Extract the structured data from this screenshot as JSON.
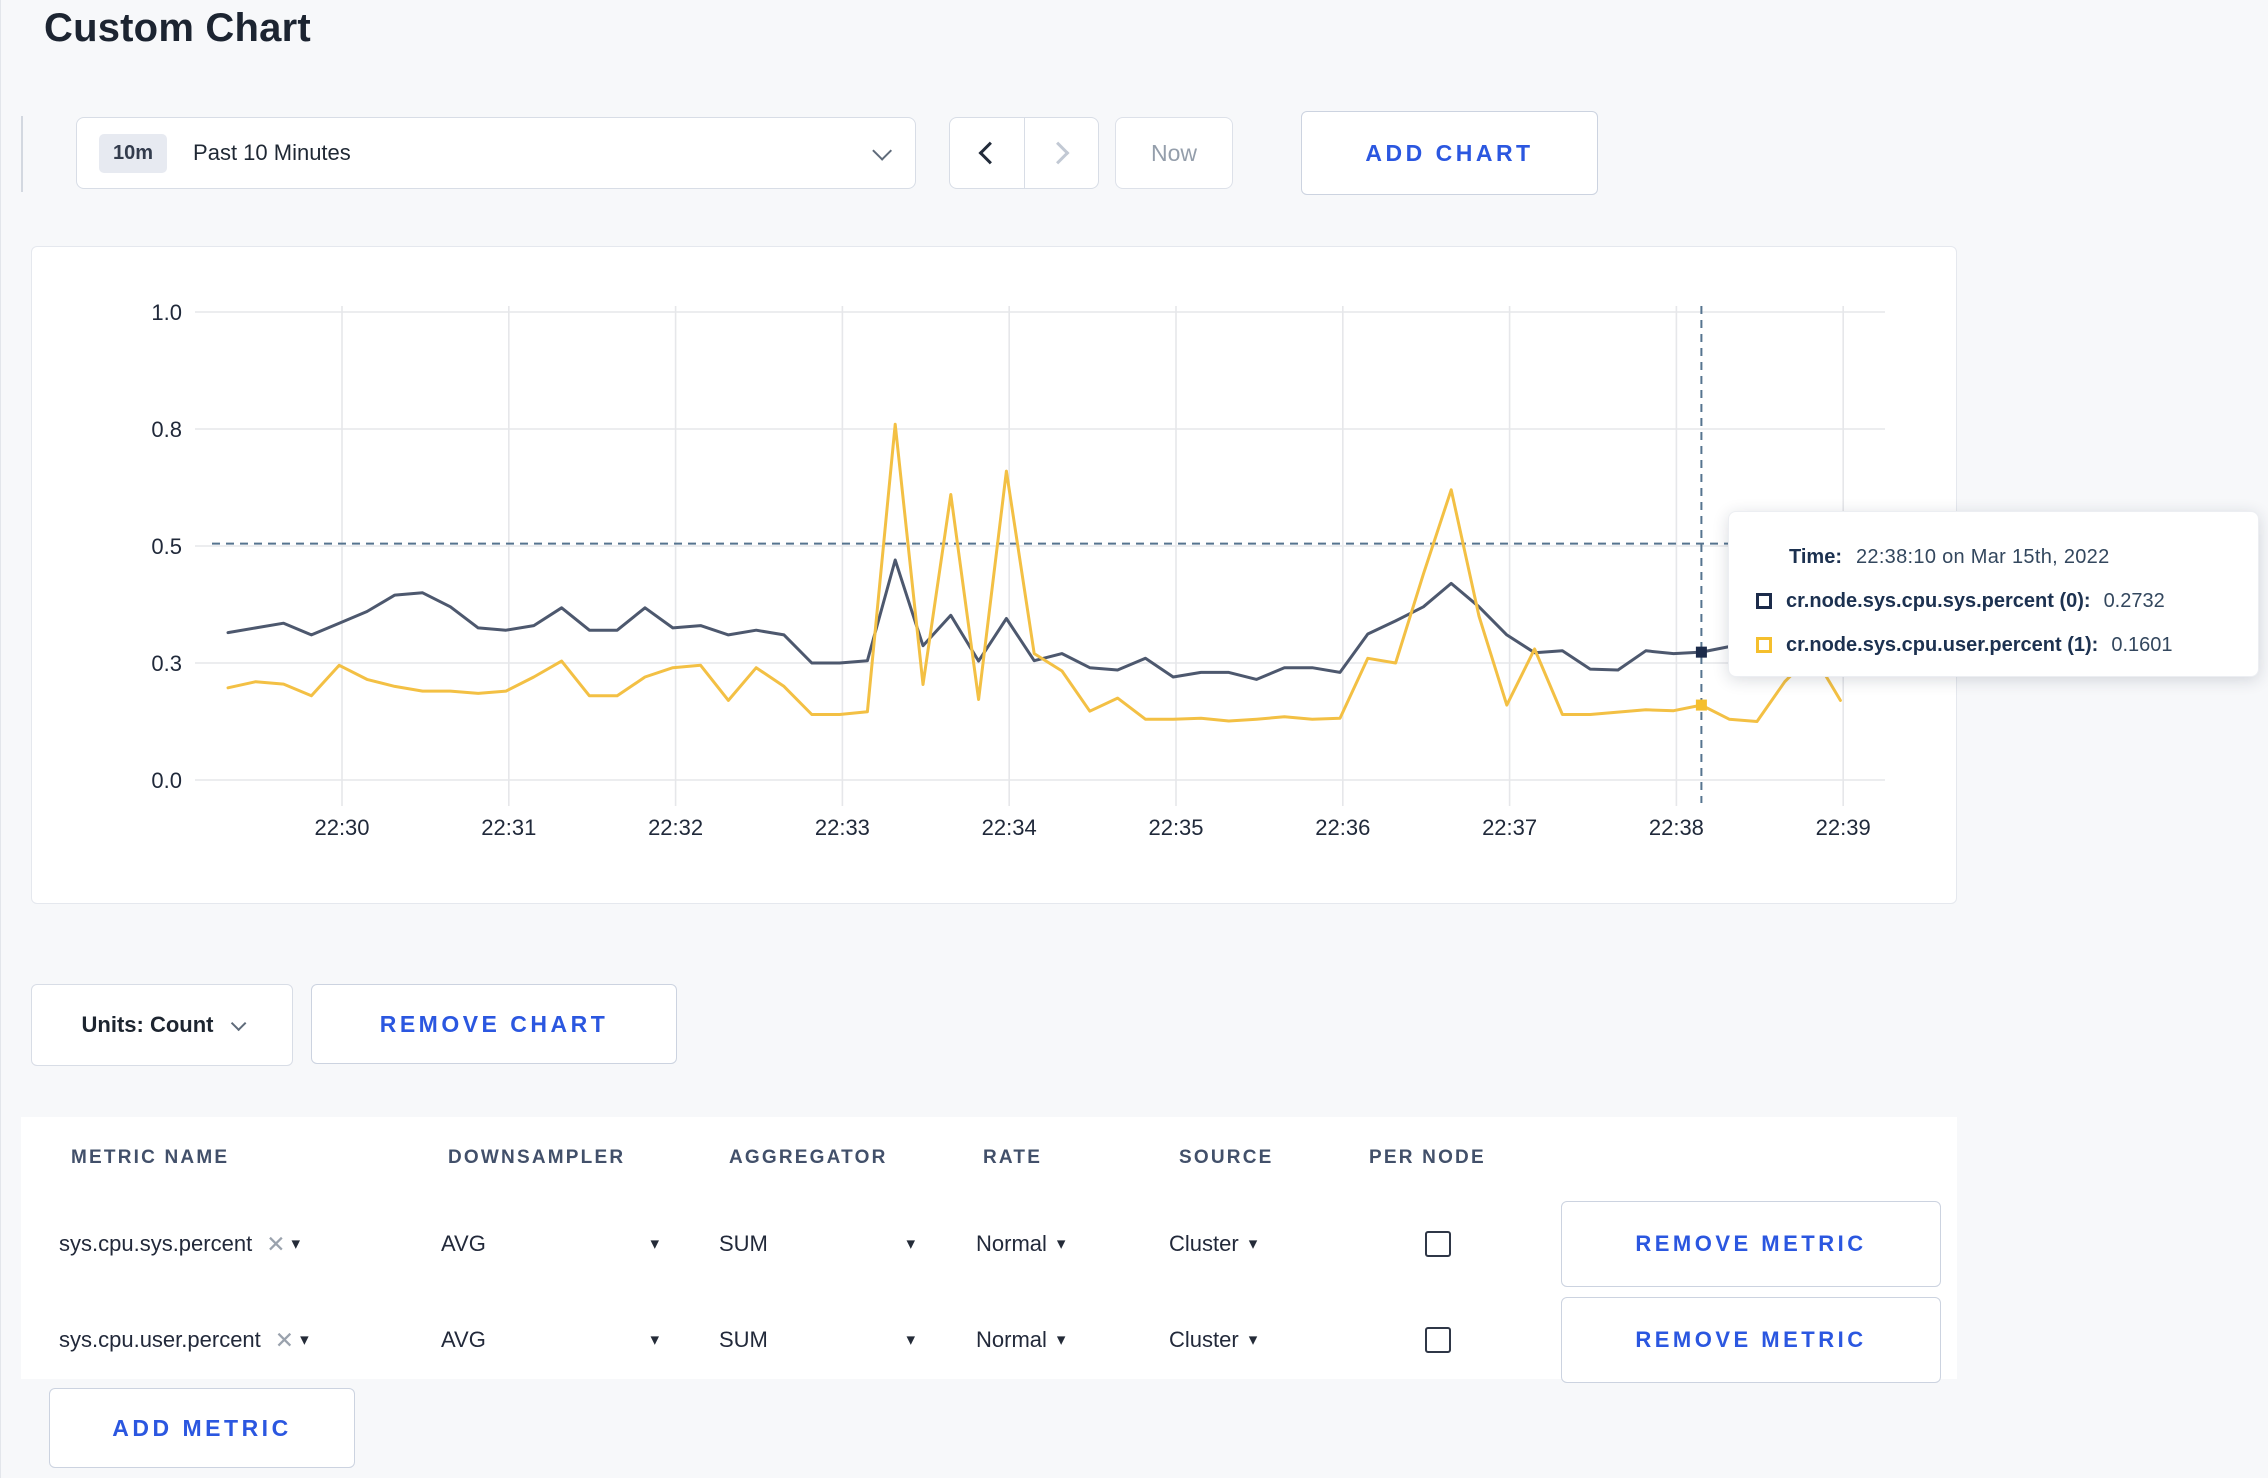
{
  "page": {
    "title": "Custom Chart"
  },
  "toolbar": {
    "time_badge": "10m",
    "time_label": "Past 10 Minutes",
    "prev_label": "previous time window",
    "next_label": "next time window",
    "now_label": "Now",
    "add_chart_label": "ADD CHART"
  },
  "icons": {
    "caret": "▾",
    "clear": "✕"
  },
  "colors": {
    "accent_blue": "#2b57e0",
    "series_sys": "#4d586e",
    "series_user": "#f3c044",
    "tooltip_sys_swatch": "#1c2b4a",
    "tooltip_user_swatch": "#f5bf2d",
    "crosshair": "#56748f",
    "gridline": "#e6e7ea"
  },
  "tooltip": {
    "time_label": "Time:",
    "time_value": "22:38:10 on Mar 15th, 2022",
    "series": [
      {
        "name": "cr.node.sys.cpu.sys.percent (0):",
        "value": "0.2732"
      },
      {
        "name": "cr.node.sys.cpu.user.percent (1):",
        "value": "0.1601"
      }
    ]
  },
  "chart_controls": {
    "units_label": "Units: Count",
    "remove_chart_label": "REMOVE CHART"
  },
  "metrics_table": {
    "headers": [
      "METRIC NAME",
      "DOWNSAMPLER",
      "AGGREGATOR",
      "RATE",
      "SOURCE",
      "PER NODE"
    ],
    "rows": [
      {
        "metric": "sys.cpu.sys.percent",
        "downsampler": "AVG",
        "aggregator": "SUM",
        "rate": "Normal",
        "source": "Cluster",
        "per_node_checked": false,
        "remove_label": "REMOVE METRIC"
      },
      {
        "metric": "sys.cpu.user.percent",
        "downsampler": "AVG",
        "aggregator": "SUM",
        "rate": "Normal",
        "source": "Cluster",
        "per_node_checked": false,
        "remove_label": "REMOVE METRIC"
      }
    ],
    "add_metric_label": "ADD METRIC"
  },
  "chart_data": {
    "type": "line",
    "title": "",
    "xlabel": "",
    "ylabel": "",
    "ylim": [
      0,
      1
    ],
    "grid": true,
    "legend_position": "tooltip",
    "x_ticks": [
      "22:30",
      "22:31",
      "22:32",
      "22:33",
      "22:34",
      "22:35",
      "22:36",
      "22:37",
      "22:38",
      "22:39"
    ],
    "y_ticks": [
      {
        "v": 0.0,
        "label": "0.0"
      },
      {
        "v": 0.25,
        "label": "0.3"
      },
      {
        "v": 0.5,
        "label": "0.5"
      },
      {
        "v": 0.75,
        "label": "0.8"
      },
      {
        "v": 1.0,
        "label": "1.0"
      }
    ],
    "start_time": "22:29:20",
    "interval_seconds": 10,
    "series": [
      {
        "name": "cr.node.sys.cpu.sys.percent",
        "color": "#4d586e",
        "values": [
          0.315,
          0.325,
          0.335,
          0.31,
          0.335,
          0.36,
          0.395,
          0.4,
          0.37,
          0.325,
          0.32,
          0.33,
          0.368,
          0.32,
          0.32,
          0.368,
          0.325,
          0.33,
          0.31,
          0.32,
          0.31,
          0.25,
          0.25,
          0.255,
          0.47,
          0.287,
          0.352,
          0.254,
          0.345,
          0.255,
          0.27,
          0.24,
          0.235,
          0.26,
          0.22,
          0.23,
          0.23,
          0.215,
          0.24,
          0.24,
          0.23,
          0.312,
          0.34,
          0.37,
          0.42,
          0.37,
          0.31,
          0.272,
          0.276,
          0.237,
          0.235,
          0.276,
          0.27,
          0.2732,
          0.285,
          0.3,
          0.29,
          0.29,
          0.29
        ]
      },
      {
        "name": "cr.node.sys.cpu.user.percent",
        "color": "#f3c044",
        "values": [
          0.197,
          0.21,
          0.205,
          0.18,
          0.245,
          0.215,
          0.2,
          0.19,
          0.19,
          0.185,
          0.19,
          0.22,
          0.254,
          0.18,
          0.18,
          0.22,
          0.24,
          0.245,
          0.17,
          0.24,
          0.2,
          0.14,
          0.14,
          0.146,
          0.76,
          0.204,
          0.61,
          0.172,
          0.66,
          0.27,
          0.233,
          0.147,
          0.175,
          0.13,
          0.13,
          0.132,
          0.126,
          0.13,
          0.135,
          0.13,
          0.132,
          0.26,
          0.25,
          0.44,
          0.62,
          0.35,
          0.16,
          0.28,
          0.14,
          0.14,
          0.145,
          0.15,
          0.148,
          0.1601,
          0.13,
          0.125,
          0.21,
          0.27,
          0.17
        ]
      }
    ],
    "crosshair": {
      "time": "22:38:10",
      "x_index": 53,
      "y_value": 0.505,
      "points": [
        0.2732,
        0.1601
      ]
    }
  }
}
